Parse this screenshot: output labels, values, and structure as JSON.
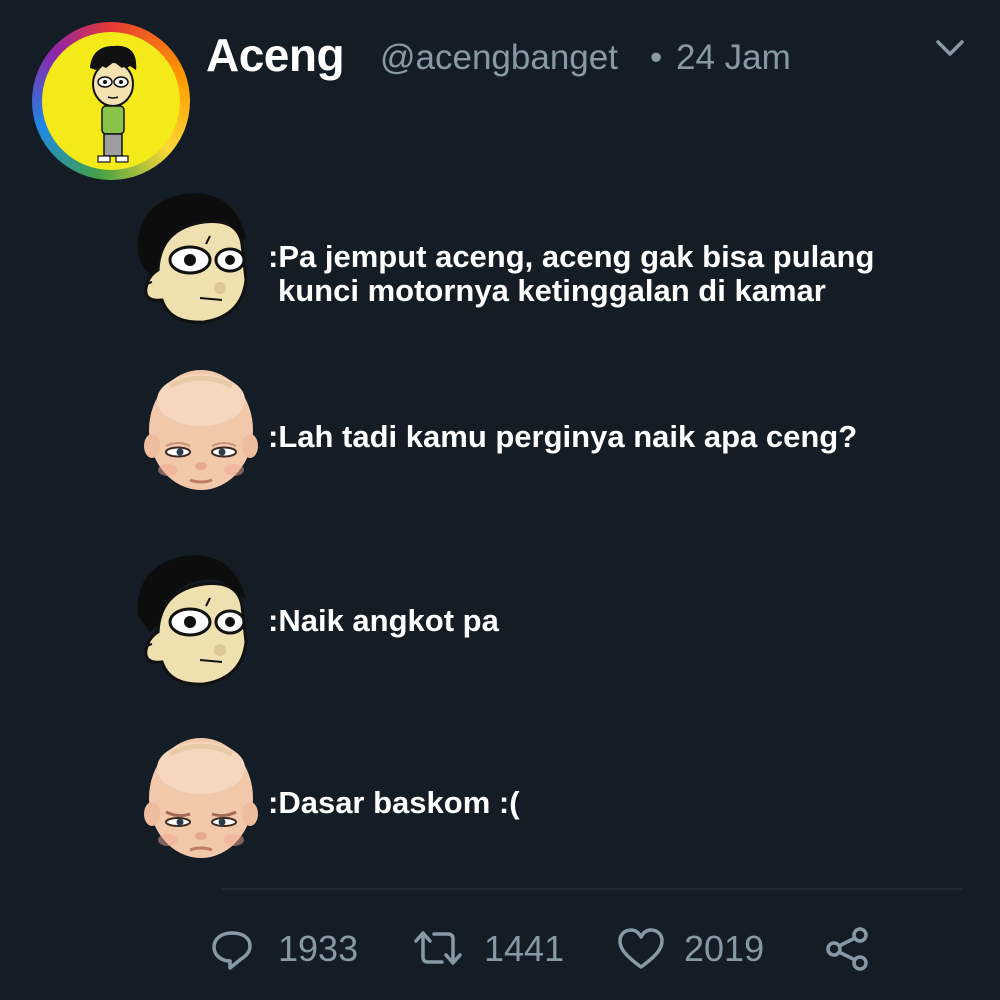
{
  "tweet": {
    "display_name": "Aceng",
    "handle": "@acengbanget",
    "separator": "•",
    "time": "24 Jam"
  },
  "messages": [
    {
      "speaker": "aceng",
      "lines": [
        ":Pa jemput aceng, aceng gak bisa pulang",
        "kunci motornya ketinggalan di kamar"
      ]
    },
    {
      "speaker": "baby",
      "lines": [
        ":Lah tadi kamu perginya naik apa ceng?"
      ]
    },
    {
      "speaker": "aceng",
      "lines": [
        ":Naik angkot pa"
      ]
    },
    {
      "speaker": "baby",
      "lines": [
        ":Dasar baskom :("
      ]
    }
  ],
  "actions": {
    "reply_count": "1933",
    "retweet_count": "1441",
    "like_count": "2019"
  },
  "icons": {
    "menu": "chevron-down-icon",
    "reply": "reply-icon",
    "retweet": "retweet-icon",
    "like": "heart-icon",
    "share": "share-icon"
  },
  "colors": {
    "background": "#141d26",
    "text": "#ffffff",
    "muted": "#8899a6"
  }
}
